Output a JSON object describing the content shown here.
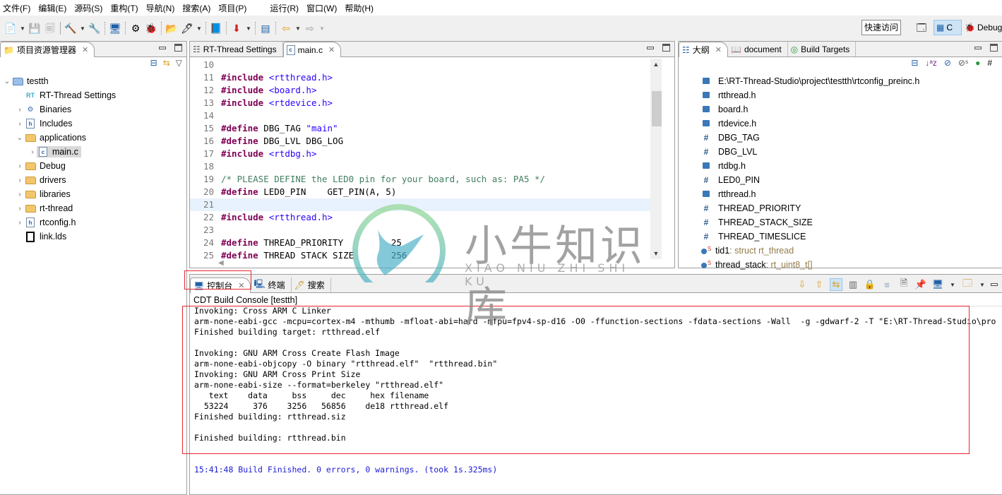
{
  "menu": [
    "文件(F)",
    "编辑(E)",
    "源码(S)",
    "重构(T)",
    "导航(N)",
    "搜索(A)",
    "项目(P)",
    "运行(R)",
    "窗口(W)",
    "帮助(H)"
  ],
  "toolbar": {
    "quick_access": "快速访问",
    "perspective_c": "C",
    "perspective_debug": "Debug"
  },
  "explorer": {
    "title": "项目资源管理器",
    "tree": [
      {
        "label": "testth",
        "icon": "c-project-icon",
        "twisty": "expanded",
        "indent": 0
      },
      {
        "label": "RT-Thread Settings",
        "icon": "rt-thread-icon",
        "twisty": "none",
        "indent": 1
      },
      {
        "label": "Binaries",
        "icon": "binaries-icon",
        "twisty": "collapsed",
        "indent": 1
      },
      {
        "label": "Includes",
        "icon": "includes-icon",
        "twisty": "collapsed",
        "indent": 1
      },
      {
        "label": "applications",
        "icon": "folder-icon",
        "twisty": "expanded",
        "indent": 1
      },
      {
        "label": "main.c",
        "icon": "c-file-icon",
        "twisty": "collapsed",
        "indent": 2,
        "selected": true
      },
      {
        "label": "Debug",
        "icon": "folder-icon",
        "twisty": "collapsed",
        "indent": 1
      },
      {
        "label": "drivers",
        "icon": "folder-icon",
        "twisty": "collapsed",
        "indent": 1
      },
      {
        "label": "libraries",
        "icon": "folder-icon",
        "twisty": "collapsed",
        "indent": 1
      },
      {
        "label": "rt-thread",
        "icon": "folder-icon",
        "twisty": "collapsed",
        "indent": 1
      },
      {
        "label": "rtconfig.h",
        "icon": "h-file-icon",
        "twisty": "collapsed",
        "indent": 1
      },
      {
        "label": "link.lds",
        "icon": "text-file-icon",
        "twisty": "none",
        "indent": 1
      }
    ]
  },
  "editor": {
    "tabs": [
      {
        "label": "RT-Thread Settings",
        "active": false
      },
      {
        "label": "main.c",
        "active": true
      }
    ],
    "lines": [
      {
        "n": "10",
        "parts": []
      },
      {
        "n": "11",
        "parts": [
          {
            "t": "#include",
            "c": "kw"
          },
          {
            "t": " "
          },
          {
            "t": "<rtthread.h>",
            "c": "inc"
          }
        ]
      },
      {
        "n": "12",
        "parts": [
          {
            "t": "#include",
            "c": "kw"
          },
          {
            "t": " "
          },
          {
            "t": "<board.h>",
            "c": "inc"
          }
        ]
      },
      {
        "n": "13",
        "parts": [
          {
            "t": "#include",
            "c": "kw"
          },
          {
            "t": " "
          },
          {
            "t": "<rtdevice.h>",
            "c": "inc"
          }
        ]
      },
      {
        "n": "14",
        "parts": []
      },
      {
        "n": "15",
        "parts": [
          {
            "t": "#define",
            "c": "kw"
          },
          {
            "t": " DBG_TAG "
          },
          {
            "t": "\"main\"",
            "c": "str"
          }
        ]
      },
      {
        "n": "16",
        "parts": [
          {
            "t": "#define",
            "c": "kw"
          },
          {
            "t": " DBG_LVL DBG_LOG"
          }
        ]
      },
      {
        "n": "17",
        "parts": [
          {
            "t": "#include",
            "c": "kw"
          },
          {
            "t": " "
          },
          {
            "t": "<rtdbg.h>",
            "c": "inc"
          }
        ]
      },
      {
        "n": "18",
        "parts": []
      },
      {
        "n": "19",
        "parts": [
          {
            "t": "/* PLEASE DEFINE the LED0 pin for your board, such as: PA5 */",
            "c": "cmt"
          }
        ]
      },
      {
        "n": "20",
        "parts": [
          {
            "t": "#define",
            "c": "kw"
          },
          {
            "t": " LED0_PIN    GET_PIN(A, 5)"
          }
        ]
      },
      {
        "n": "21",
        "parts": [],
        "current": true
      },
      {
        "n": "22",
        "parts": [
          {
            "t": "#include",
            "c": "kw"
          },
          {
            "t": " "
          },
          {
            "t": "<rtthread.h>",
            "c": "inc"
          }
        ]
      },
      {
        "n": "23",
        "parts": []
      },
      {
        "n": "24",
        "parts": [
          {
            "t": "#define",
            "c": "kw"
          },
          {
            "t": " THREAD_PRIORITY         25"
          }
        ]
      },
      {
        "n": "25",
        "parts": [
          {
            "t": "#define",
            "c": "kw"
          },
          {
            "t": " THREAD_STACK_SIZE       256"
          }
        ]
      }
    ]
  },
  "outline": {
    "tabs": [
      {
        "label": "大纲",
        "active": true
      },
      {
        "label": "document",
        "active": false
      },
      {
        "label": "Build Targets",
        "active": false
      }
    ],
    "items": [
      {
        "kind": "include",
        "label": "E:\\RT-Thread-Studio\\project\\testth\\rtconfig_preinc.h"
      },
      {
        "kind": "include",
        "label": "rtthread.h"
      },
      {
        "kind": "include",
        "label": "board.h"
      },
      {
        "kind": "include",
        "label": "rtdevice.h"
      },
      {
        "kind": "macro",
        "label": "DBG_TAG"
      },
      {
        "kind": "macro",
        "label": "DBG_LVL"
      },
      {
        "kind": "include",
        "label": "rtdbg.h"
      },
      {
        "kind": "macro",
        "label": "LED0_PIN"
      },
      {
        "kind": "include",
        "label": "rtthread.h"
      },
      {
        "kind": "macro",
        "label": "THREAD_PRIORITY"
      },
      {
        "kind": "macro",
        "label": "THREAD_STACK_SIZE"
      },
      {
        "kind": "macro",
        "label": "THREAD_TIMESLICE"
      },
      {
        "kind": "static-var",
        "label": "tid1",
        "type": " : struct rt_thread"
      },
      {
        "kind": "static-var",
        "label": "thread_stack",
        "type": " : rt_uint8_t[]"
      }
    ]
  },
  "console": {
    "tabs": [
      {
        "label": "控制台",
        "active": true
      },
      {
        "label": "终端",
        "active": false
      },
      {
        "label": "搜索",
        "active": false
      }
    ],
    "title": "CDT Build Console [testth]",
    "lines": [
      {
        "text": "Invoking: Cross ARM C Linker"
      },
      {
        "text": "arm-none-eabi-gcc -mcpu=cortex-m4 -mthumb -mfloat-abi=hard -mfpu=fpv4-sp-d16 -O0 -ffunction-sections -fdata-sections -Wall  -g -gdwarf-2 -T \"E:\\RT-Thread-Studio\\pro"
      },
      {
        "text": "Finished building target: rtthread.elf"
      },
      {
        "text": ""
      },
      {
        "text": "Invoking: GNU ARM Cross Create Flash Image"
      },
      {
        "text": "arm-none-eabi-objcopy -O binary \"rtthread.elf\"  \"rtthread.bin\""
      },
      {
        "text": "Invoking: GNU ARM Cross Print Size"
      },
      {
        "text": "arm-none-eabi-size --format=berkeley \"rtthread.elf\""
      },
      {
        "text": "   text    data     bss     dec     hex filename"
      },
      {
        "text": "  53224     376    3256   56856    de18 rtthread.elf"
      },
      {
        "text": "Finished building: rtthread.siz"
      },
      {
        "text": ""
      },
      {
        "text": "Finished building: rtthread.bin"
      },
      {
        "text": ""
      },
      {
        "text": ""
      },
      {
        "text": "15:41:48 Build Finished. 0 errors, 0 warnings. (took 1s.325ms)",
        "color": "blue"
      }
    ]
  },
  "watermark": {
    "title": "小牛知识库",
    "subtitle": "XIAO NIU ZHI SHI KU"
  },
  "colors": {
    "annotation": "#e8262e",
    "keyword": "#7f0055",
    "string": "#2a00ff",
    "comment": "#3f7f5f",
    "build_finished": "#1c1cd8"
  }
}
